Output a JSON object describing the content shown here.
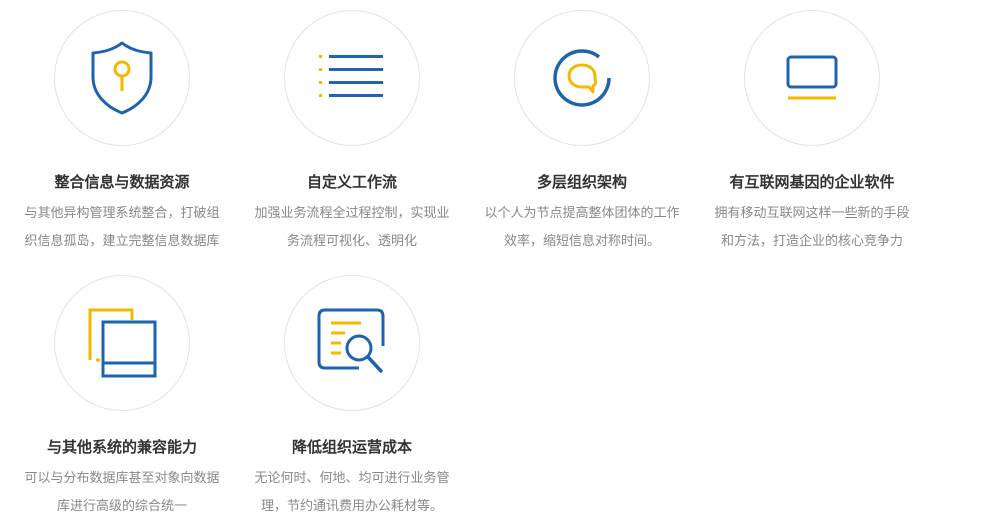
{
  "colors": {
    "blue": "#1e63ad",
    "yellow": "#f5b800",
    "circle_border": "#e3e3e3",
    "title": "#333333",
    "desc": "#888888"
  },
  "features": [
    {
      "icon": "shield-key-icon",
      "title": "整合信息与数据资源",
      "desc_lines": [
        "与其他异构管理系统整合，打破组",
        "织信息孤岛，建立完整信息数据库"
      ]
    },
    {
      "icon": "list-icon",
      "title": "自定义工作流",
      "desc_lines": [
        "加强业务流程全过程控制，实现业",
        "务流程可视化、透明化"
      ]
    },
    {
      "icon": "chat-bubble-icon",
      "title": "多层组织架构",
      "desc_lines": [
        "以个人为节点提高整体团体的工作",
        "效率，缩短信息对称时间。"
      ]
    },
    {
      "icon": "monitor-icon",
      "title": "有互联网基因的企业软件",
      "desc_lines": [
        "拥有移动互联网这样一些新的手段",
        "和方法，打造企业的核心竞争力"
      ]
    },
    {
      "icon": "windows-stack-icon",
      "title": "与其他系统的兼容能力",
      "desc_lines": [
        "可以与分布数据库甚至对象向数据",
        "库进行高级的综合统一"
      ]
    },
    {
      "icon": "document-search-icon",
      "title": "降低组织运营成本",
      "desc_lines": [
        "无论何时、何地、均可进行业务管",
        "理，节约通讯费用办公耗材等。"
      ]
    }
  ]
}
